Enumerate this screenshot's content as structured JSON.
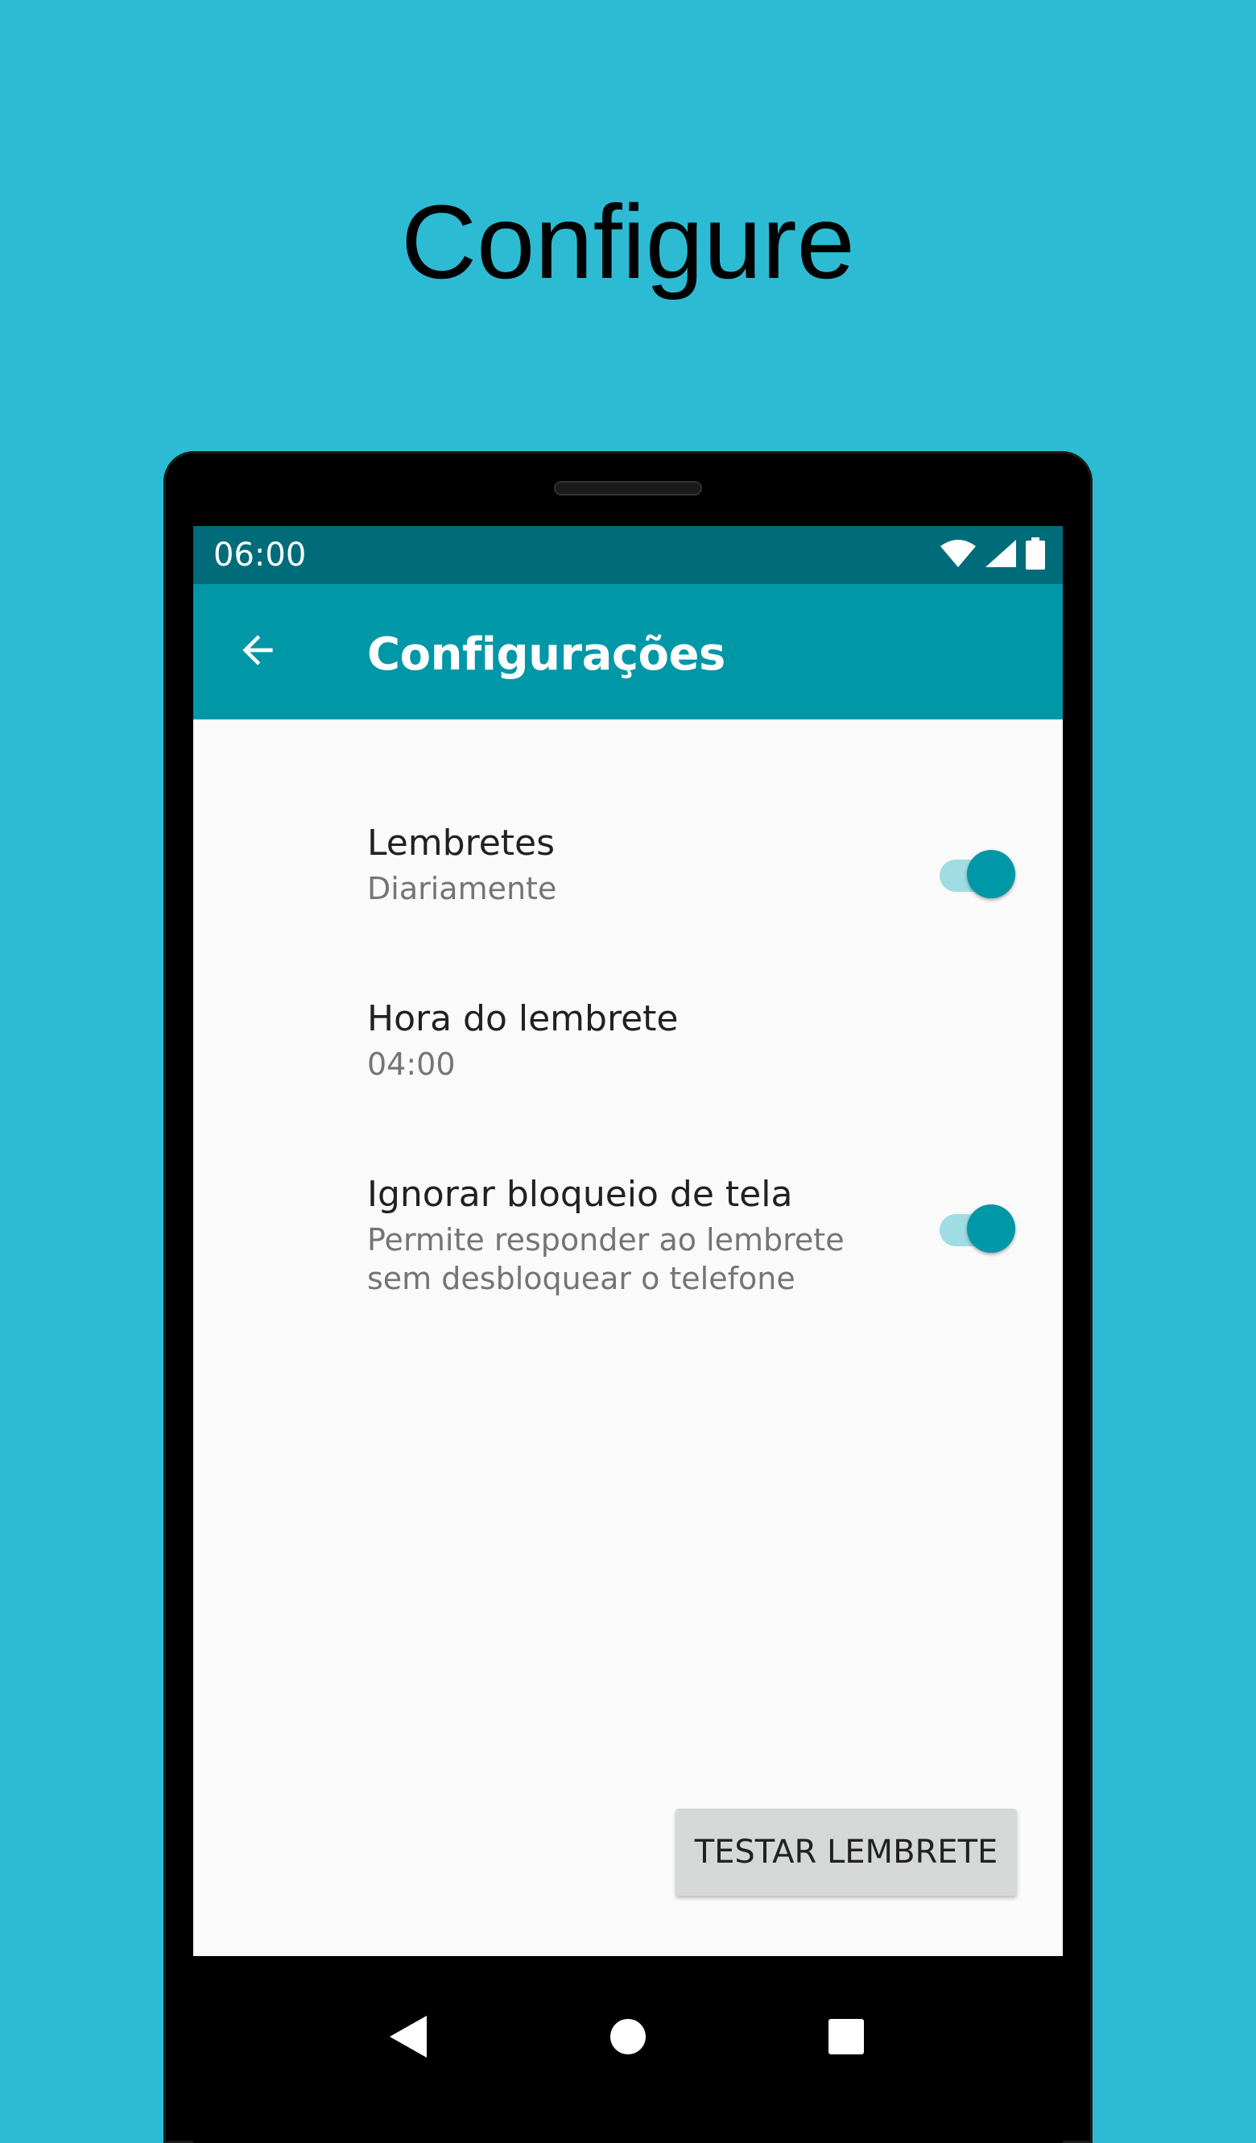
{
  "promo": {
    "title": "Configure"
  },
  "status_bar": {
    "time": "06:00",
    "icons": [
      "wifi-icon",
      "signal-icon",
      "battery-icon"
    ]
  },
  "app_bar": {
    "title": "Configurações",
    "back_icon": "arrow-back-icon"
  },
  "preferences": {
    "reminders": {
      "title": "Lembretes",
      "summary": "Diariamente",
      "enabled": true
    },
    "reminder_time": {
      "title": "Hora do lembrete",
      "summary": "04:00"
    },
    "ignore_lock": {
      "title": "Ignorar bloqueio de tela",
      "summary_line1": "Permite responder ao lembrete",
      "summary_line2": "sem desbloquear o telefone",
      "enabled": true
    }
  },
  "test_button": {
    "label": "TESTAR LEMBRETE"
  },
  "nav_bar": {
    "icons": [
      "nav-back-icon",
      "nav-home-icon",
      "nav-recents-icon"
    ]
  },
  "colors": {
    "background": "#2dbbd3",
    "status_bar": "#006c7a",
    "app_bar": "#0097a7",
    "accent": "#0097a7",
    "switch_track": "#9fdde3",
    "screen": "#fafafa",
    "button": "#d6d7d7"
  }
}
